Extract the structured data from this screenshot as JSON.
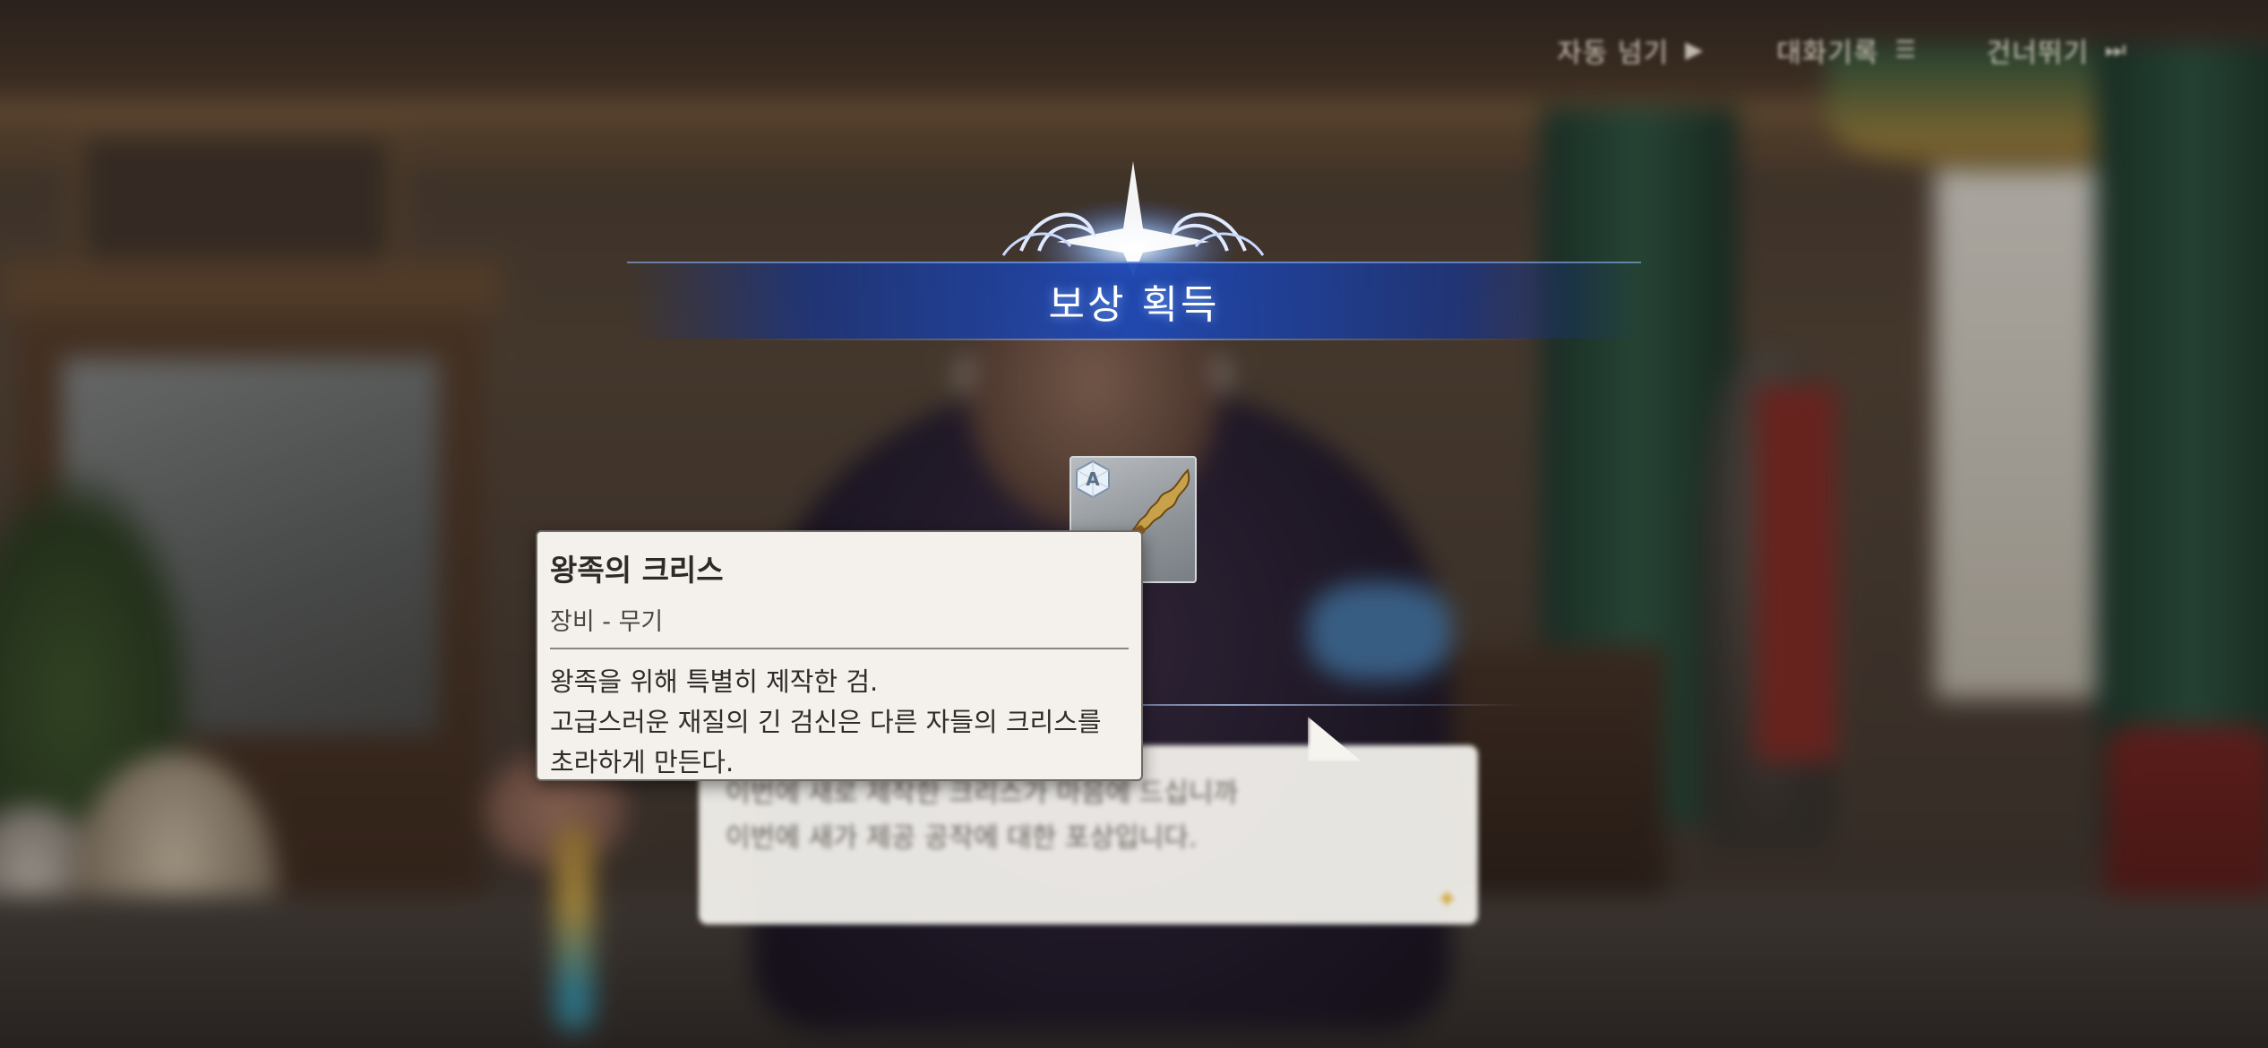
{
  "top_menu": {
    "items": [
      {
        "label": "자동 넘기",
        "icon": "play-arrow-icon"
      },
      {
        "label": "대화기록",
        "icon": "log-icon"
      },
      {
        "label": "건너뛰기",
        "icon": "skip-icon"
      }
    ]
  },
  "reward": {
    "title": "보상 획득"
  },
  "item": {
    "grade": "A",
    "icon": "kris-sword-icon"
  },
  "tooltip": {
    "name": "왕족의 크리스",
    "type": "장비 - 무기",
    "description": [
      "왕족을 위해 특별히 제작한 검.",
      "고급스러운 재질의 긴 검신은 다른 자들의 크리스를",
      "초라하게 만든다."
    ]
  },
  "dialogue": {
    "lines": [
      "이번에 새로 제작한 크리스가 마음에 드십니까",
      "이번에 새가 제공 공작에 대한 포상입니다."
    ]
  },
  "colors": {
    "banner_blue": "#1e48b4",
    "tooltip_bg": "#f4f1ec",
    "tooltip_text": "#2d2a28"
  }
}
